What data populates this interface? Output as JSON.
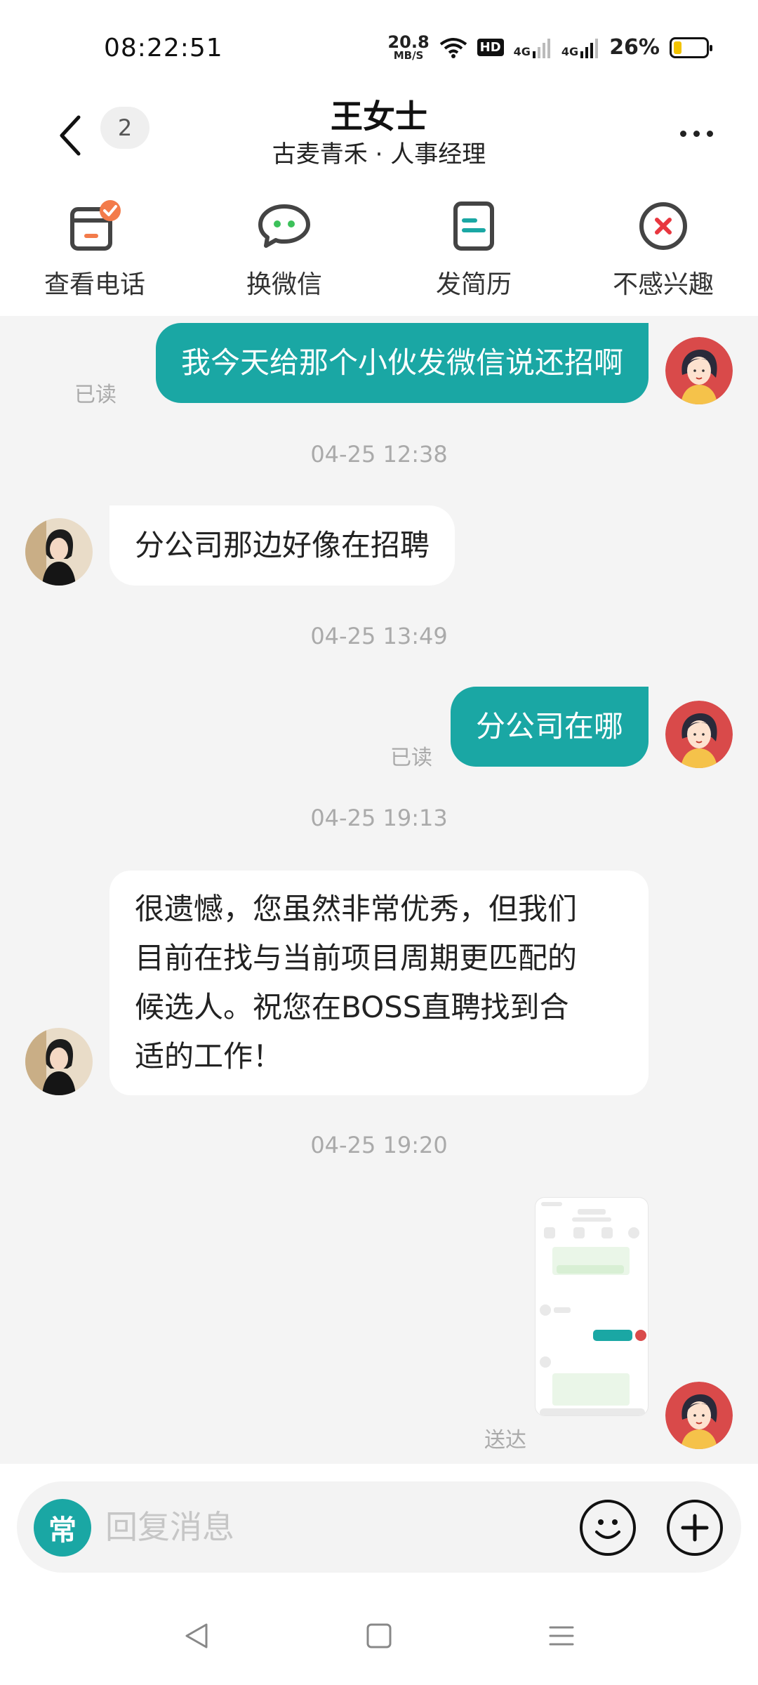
{
  "status_bar": {
    "time": "08:22:51",
    "net_speed_value": "20.8",
    "net_speed_unit": "MB/S",
    "hd_label": "HD",
    "signal1_label": "4G",
    "signal2_label": "4G",
    "battery_percent": "26%",
    "battery_level": 0.26,
    "battery_color": "#f2c300"
  },
  "header": {
    "unread_count": "2",
    "contact_name": "王女士",
    "contact_subtitle": "古麦青禾 · 人事经理"
  },
  "actions": [
    {
      "label": "查看电话",
      "icon": "phone-card-icon"
    },
    {
      "label": "换微信",
      "icon": "wechat-bubble-icon"
    },
    {
      "label": "发简历",
      "icon": "resume-icon"
    },
    {
      "label": "不感兴趣",
      "icon": "not-interested-icon"
    }
  ],
  "messages": {
    "m1": {
      "text": "我今天给那个小伙发微信说还招啊",
      "status": "已读"
    },
    "t1": "04-25 12:38",
    "m2": {
      "text": "分公司那边好像在招聘"
    },
    "t2": "04-25 13:49",
    "m3": {
      "text": "分公司在哪",
      "status": "已读"
    },
    "t3": "04-25 19:13",
    "m4": {
      "lines": [
        "很遗憾，您虽然非常优秀，但我们",
        "目前在找与当前项目周期更匹配的",
        "候选人。祝您在BOSS直聘找到合",
        "适的工作！"
      ]
    },
    "t4": "04-25 19:20",
    "m5": {
      "type": "image",
      "status": "送达"
    }
  },
  "input": {
    "quick_label": "常",
    "placeholder": "回复消息"
  },
  "colors": {
    "accent": "#1aa7a4",
    "badge": "#f37b4a",
    "reject": "#e8373f"
  }
}
